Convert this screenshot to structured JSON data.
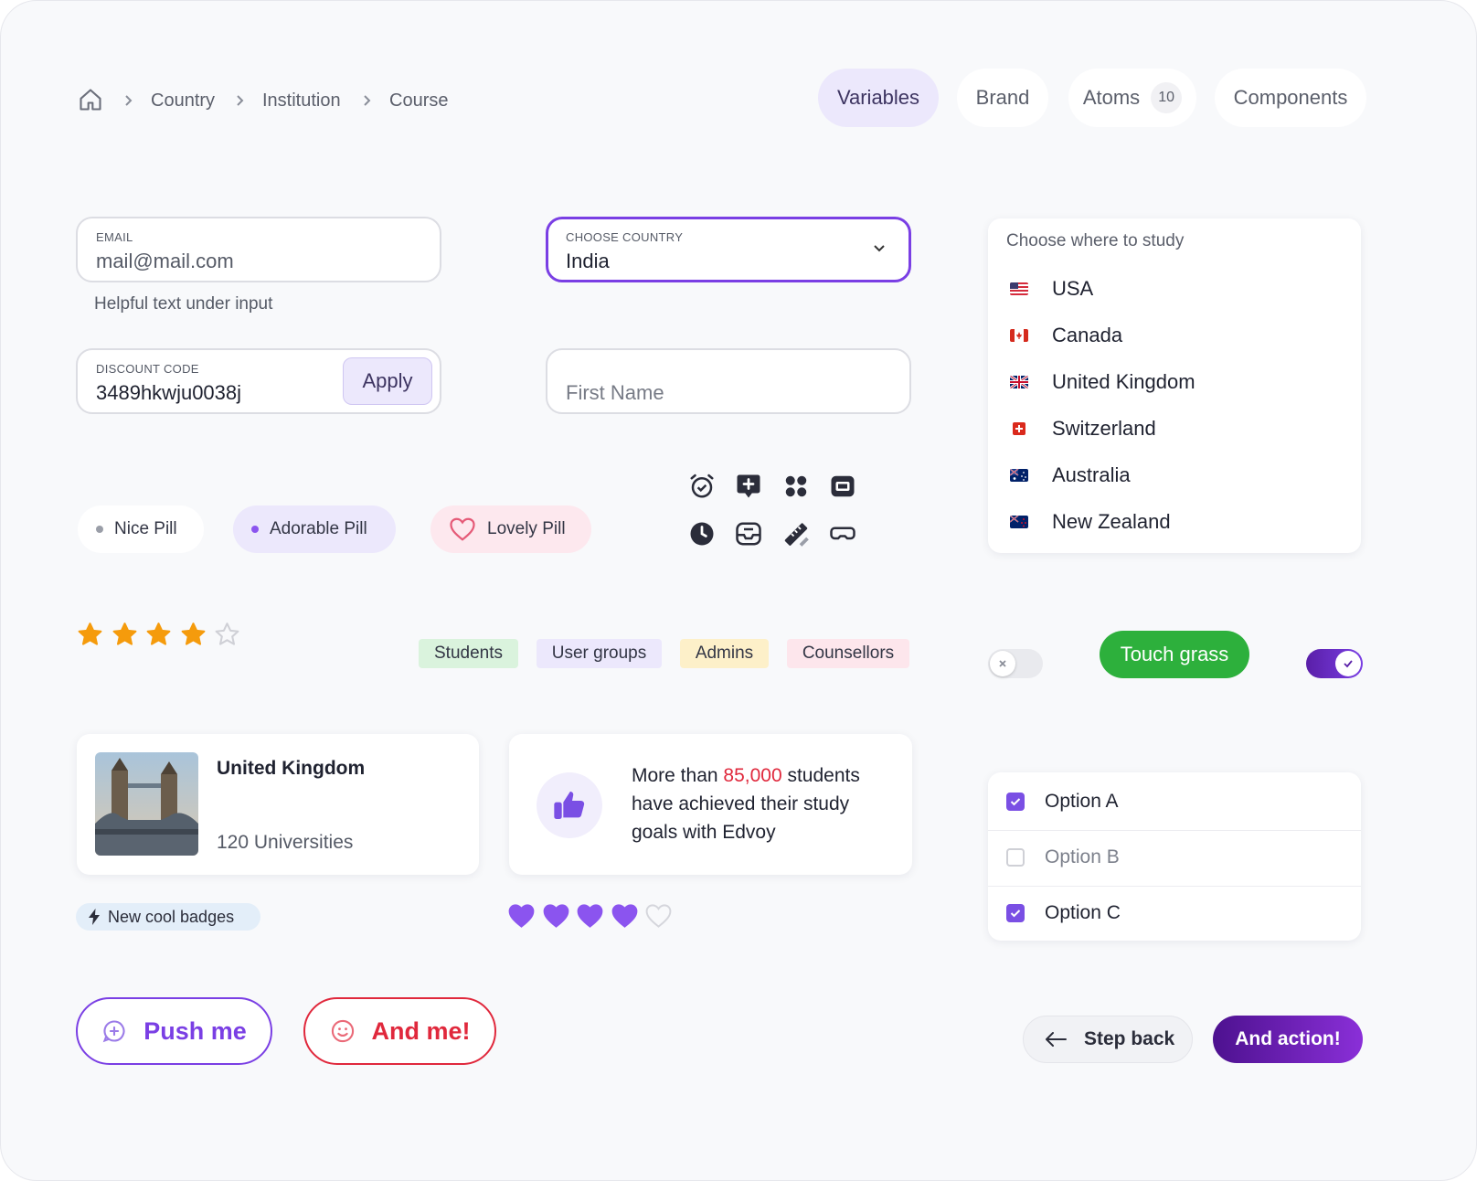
{
  "breadcrumb": {
    "items": [
      "Country",
      "Institution",
      "Course"
    ]
  },
  "tabs": [
    {
      "label": "Variables"
    },
    {
      "label": "Brand"
    },
    {
      "label": "Atoms",
      "count": "10"
    },
    {
      "label": "Components"
    }
  ],
  "email": {
    "label": "EMAIL",
    "value": "mail@mail.com",
    "helper": "Helpful text under input"
  },
  "country_select": {
    "label": "CHOOSE COUNTRY",
    "value": "India"
  },
  "discount": {
    "label": "DISCOUNT CODE",
    "value": "3489hkwju0038j",
    "button": "Apply"
  },
  "first_name": {
    "placeholder": "First Name"
  },
  "study_list": {
    "title": "Choose where to study",
    "items": [
      "USA",
      "Canada",
      "United Kingdom",
      "Switzerland",
      "Australia",
      "New Zealand"
    ]
  },
  "pills": [
    "Nice Pill",
    "Adorable Pill",
    "Lovely Pill"
  ],
  "icons": [
    "alarm-check-icon",
    "message-plus-icon",
    "dots-grid-icon",
    "video-frame-icon",
    "clock-icon",
    "inbox-icon",
    "ruler-pencil-icon",
    "vr-goggles-icon"
  ],
  "rating": {
    "value": 4,
    "max": 5
  },
  "tags": [
    "Students",
    "User groups",
    "Admins",
    "Counsellors"
  ],
  "toggles": {
    "off_state": false,
    "on_state": true
  },
  "touch_grass": "Touch grass",
  "uk_card": {
    "title": "United Kingdom",
    "subtitle": "120 Universities"
  },
  "stat_card": {
    "before": "More than ",
    "highlight": "85,000",
    "after": " students have achieved their study goals with Edvoy"
  },
  "badge": "New cool badges",
  "hearts": {
    "value": 4,
    "max": 5
  },
  "options": [
    {
      "label": "Option A",
      "checked": true
    },
    {
      "label": "Option B",
      "checked": false
    },
    {
      "label": "Option C",
      "checked": true
    }
  ],
  "buttons": {
    "push": "Push me",
    "and_me": "And me!",
    "step_back": "Step back",
    "action": "And action!"
  },
  "colors": {
    "accent": "#7a3fe4",
    "danger": "#e0283c",
    "success": "#2db03c",
    "star": "#f59b0c",
    "heart": "#8b54ef"
  }
}
